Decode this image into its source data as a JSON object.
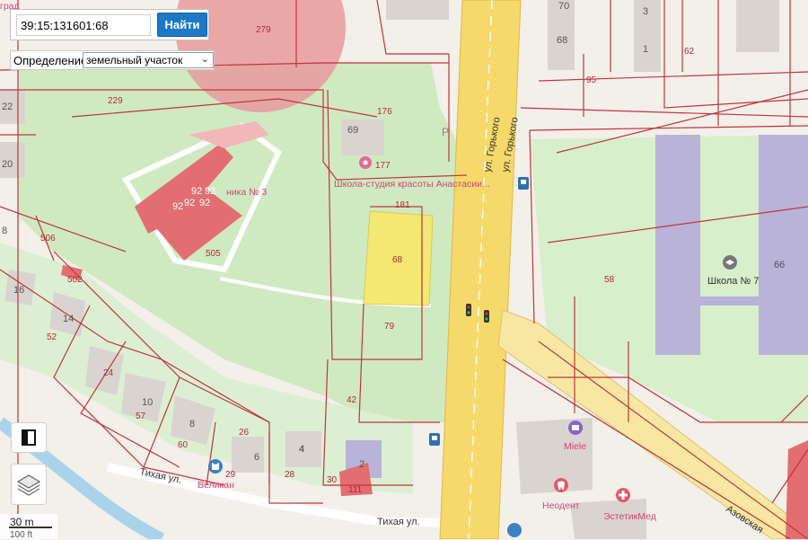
{
  "search": {
    "value": "39:15:131601:68",
    "button_label": "Найти"
  },
  "definition": {
    "label": "Определение:",
    "selected": "земельный участок"
  },
  "scale": {
    "label": "30 m",
    "secondary": "100 ft"
  },
  "streets": {
    "gorkogo_1": "ул. Горького",
    "gorkogo_2": "ул. Горького",
    "tikhaya_1": "Тихая ул.",
    "tikhaya_2": "Тихая ул.",
    "azovskaya": "Азовская"
  },
  "cadastral_labels": [
    "279",
    "229",
    "176",
    "177",
    "181",
    "68",
    "505",
    "506",
    "502",
    "79",
    "42",
    "58",
    "62",
    "95",
    "24",
    "57",
    "60",
    "29",
    "28",
    "26",
    "30",
    "111",
    "52",
    "92",
    "92",
    "92",
    "92",
    "92",
    "92",
    "6",
    "6",
    "4",
    "2",
    "69"
  ],
  "house_numbers": [
    "70",
    "68",
    "3",
    "1",
    "22",
    "20",
    "8",
    "16",
    "14",
    "10",
    "8",
    "4",
    "2",
    "66"
  ],
  "pois": {
    "beauty_salon": "Школа-студия красоты Анастасии...",
    "polyclinic": "ника № 3",
    "school": "Школа № 7",
    "miele": "Miele",
    "neodent": "Неодент",
    "estetikmed": "ЭстетикМед",
    "velikan": "Великан",
    "top_cut": "град"
  },
  "selected_parcel": {
    "label": "68",
    "color": "#f6e86a"
  },
  "colors": {
    "boundary": "#c0353d",
    "road": "#f5d96b",
    "green": "#cfeac1",
    "building": "#d9d4cf",
    "hospital": "#e36e71",
    "school": "#b9b3d8",
    "water": "#a8d3ea"
  },
  "icons": [
    "layers-icon",
    "bookmark-icon",
    "parking-icon",
    "traffic-light-icon",
    "bus-stop-icon",
    "school-icon",
    "salon-icon",
    "clinic-icon",
    "hospital-icon",
    "shop-icon"
  ]
}
